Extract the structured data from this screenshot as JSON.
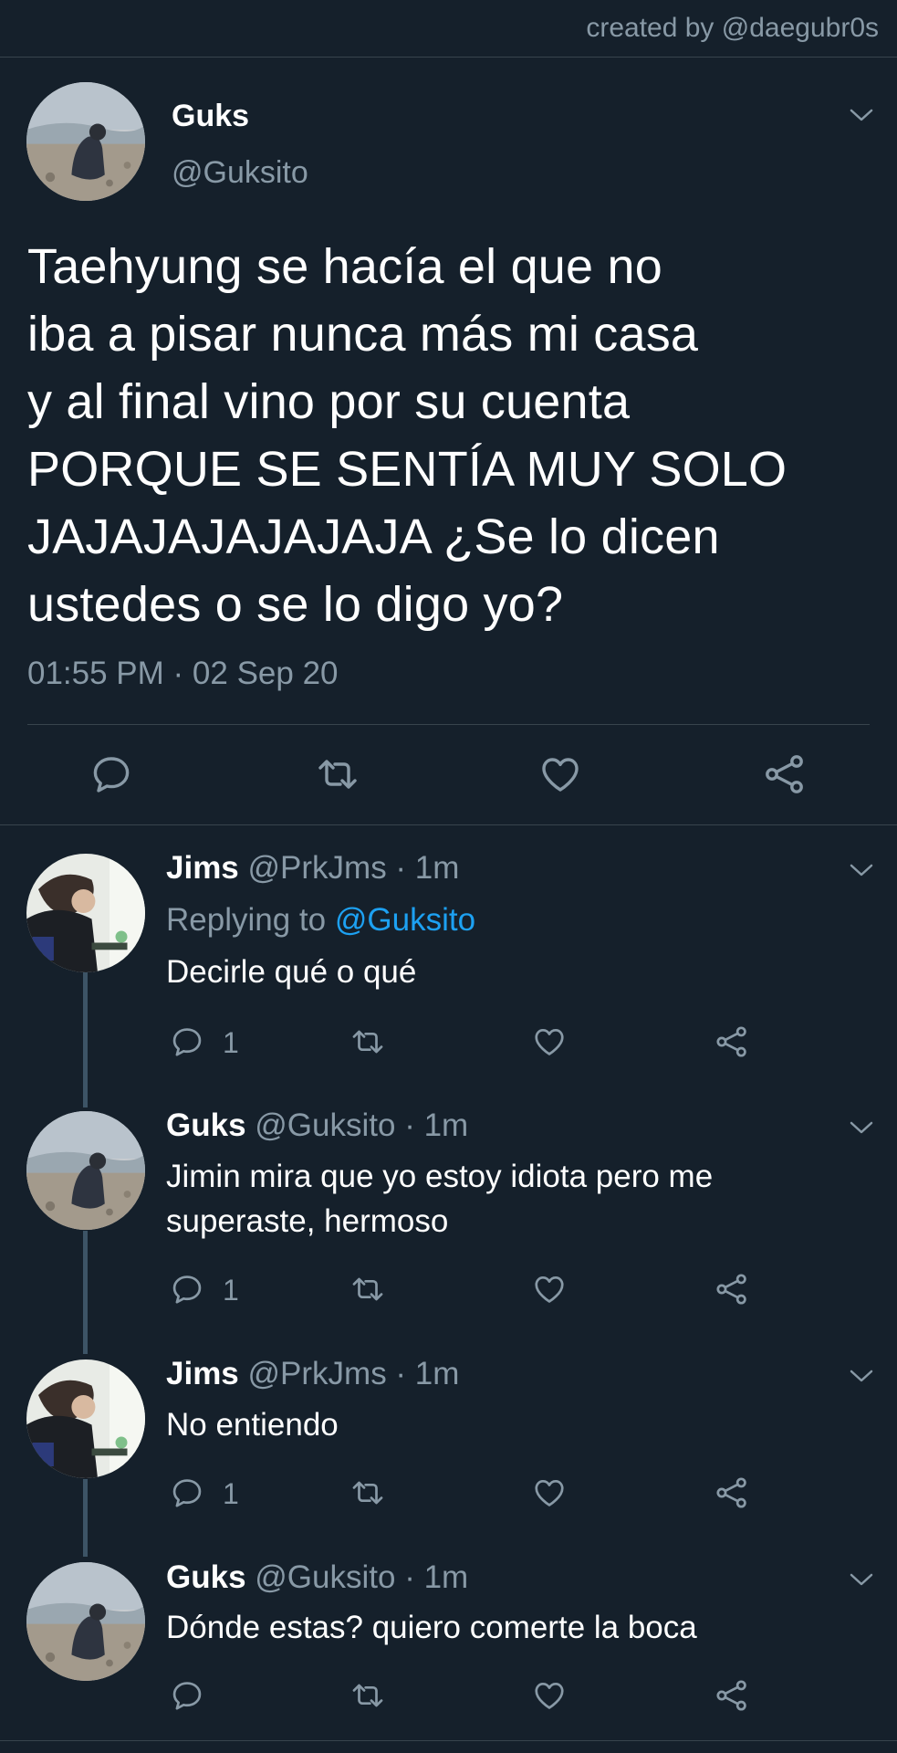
{
  "credit": "created by @daegubr0s",
  "main_tweet": {
    "name": "Guks",
    "handle": "@Guksito",
    "text": "Taehyung se hacía el que no\niba a pisar nunca más mi casa\ny al final vino por su cuenta\nPORQUE SE SENTÍA MUY SOLO\nJAJAJAJAJAJAJA ¿Se lo dicen\nustedes o se lo digo yo?",
    "timestamp": "01:55 PM · 02 Sep 20",
    "actions": [
      "reply-icon",
      "retweet-icon",
      "like-icon",
      "share-icon"
    ]
  },
  "replies": [
    {
      "name": "Jims",
      "meta": "@PrkJms · 1m",
      "replying_label": "Replying to",
      "replying_to": "@Guksito",
      "text": "Decirle qué o qué",
      "reply_count": "1"
    },
    {
      "name": "Guks",
      "meta": "@Guksito · 1m",
      "text": "Jimin mira que yo estoy idiota pero me superaste, hermoso",
      "reply_count": "1"
    },
    {
      "name": "Jims",
      "meta": "@PrkJms · 1m",
      "text": "No entiendo",
      "reply_count": "1"
    },
    {
      "name": "Guks",
      "meta": "@Guksito · 1m",
      "text": "Dónde estas? quiero comerte la boca",
      "reply_count": ""
    }
  ],
  "colors": {
    "background": "#15202b",
    "secondary_text": "#8899a6",
    "link": "#1da1f2",
    "divider": "#38444d",
    "thread_line": "#3d5466"
  }
}
